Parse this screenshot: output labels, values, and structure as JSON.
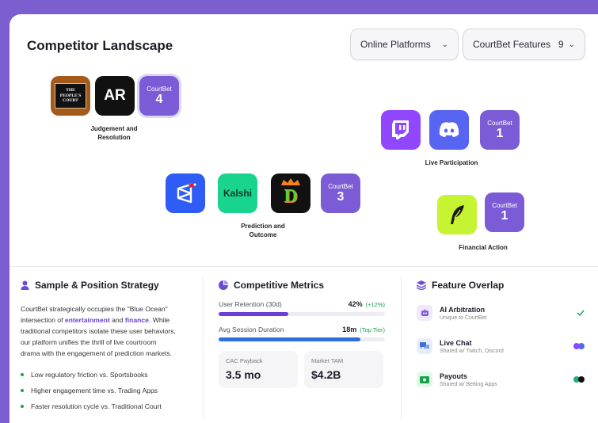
{
  "header": {
    "title": "Competitor Landscape",
    "filter_platforms": {
      "label": "Online Platforms"
    },
    "filter_features": {
      "label": "CourtBet Features",
      "count": "9"
    }
  },
  "clusters": {
    "judgement": {
      "label_line1": "Judgement and",
      "label_line2": "Resolution",
      "peoples_court_text": [
        "THE",
        "PEOPLE'S",
        "COURT"
      ],
      "ar_text": "AR",
      "courtbet": {
        "name": "CourtBet",
        "count": "4"
      }
    },
    "live": {
      "label": "Live Participation",
      "courtbet": {
        "name": "CourtBet",
        "count": "1"
      }
    },
    "prediction": {
      "label_line1": "Prediction and",
      "label_line2": "Outcome",
      "kalshi_text": "Kalshi",
      "draftkings_text": "D",
      "courtbet": {
        "name": "CourtBet",
        "count": "3"
      }
    },
    "financial": {
      "label": "Financial Action",
      "courtbet": {
        "name": "CourtBet",
        "count": "1"
      }
    }
  },
  "strategy": {
    "title": "Sample & Position Strategy",
    "p1": "CourtBet strategically occupies the \"Blue Ocean\"",
    "p2a": "intersection of ",
    "p2b": "entertainment",
    "p2c": " and ",
    "p2d": "finance",
    "p2e": ". While",
    "p3": "traditional competitors isolate these user behaviors,",
    "p4": "our platform unifies the thrill of live courtroom",
    "p5": "drama with the engagement of prediction markets.",
    "bullets": [
      "Low regulatory friction vs. Sportsbooks",
      "Higher engagement time vs. Trading Apps",
      "Faster resolution cycle vs. Traditional Court"
    ]
  },
  "metrics": {
    "title": "Competitive Metrics",
    "retention": {
      "label": "User Retention (30d)",
      "value": "42%",
      "note": "(+12%)",
      "level": 0.42
    },
    "session": {
      "label": "Avg Session Duration",
      "value": "18m",
      "note": "(Top Tier)",
      "level": 0.85
    },
    "cac": {
      "label": "CAC Payback",
      "value": "3.5 mo"
    },
    "tam": {
      "label": "Market TAM",
      "value": "$4.2B"
    }
  },
  "overlap": {
    "title": "Feature Overlap",
    "items": [
      {
        "title": "AI Arbitration",
        "sub": "Unique to CourtBet"
      },
      {
        "title": "Live Chat",
        "sub": "Shared w/ Twitch, Discord"
      },
      {
        "title": "Payouts",
        "sub": "Shared w/ Betting Apps"
      }
    ]
  },
  "colors": {
    "accent": "#7c5cd6",
    "frame": "#7b5fd0",
    "twitch": "#9146ff",
    "discord": "#5865f2",
    "kalshi": "#19d48c",
    "robinhood": "#c6f432",
    "positive": "#16a34a"
  },
  "icons": [
    "user-icon",
    "pie-chart-icon",
    "layers-icon",
    "chevron-down-icon",
    "check-icon",
    "robot-icon",
    "chat-icon",
    "money-icon",
    "twitch-icon",
    "discord-icon",
    "feather-icon",
    "crown-icon"
  ]
}
